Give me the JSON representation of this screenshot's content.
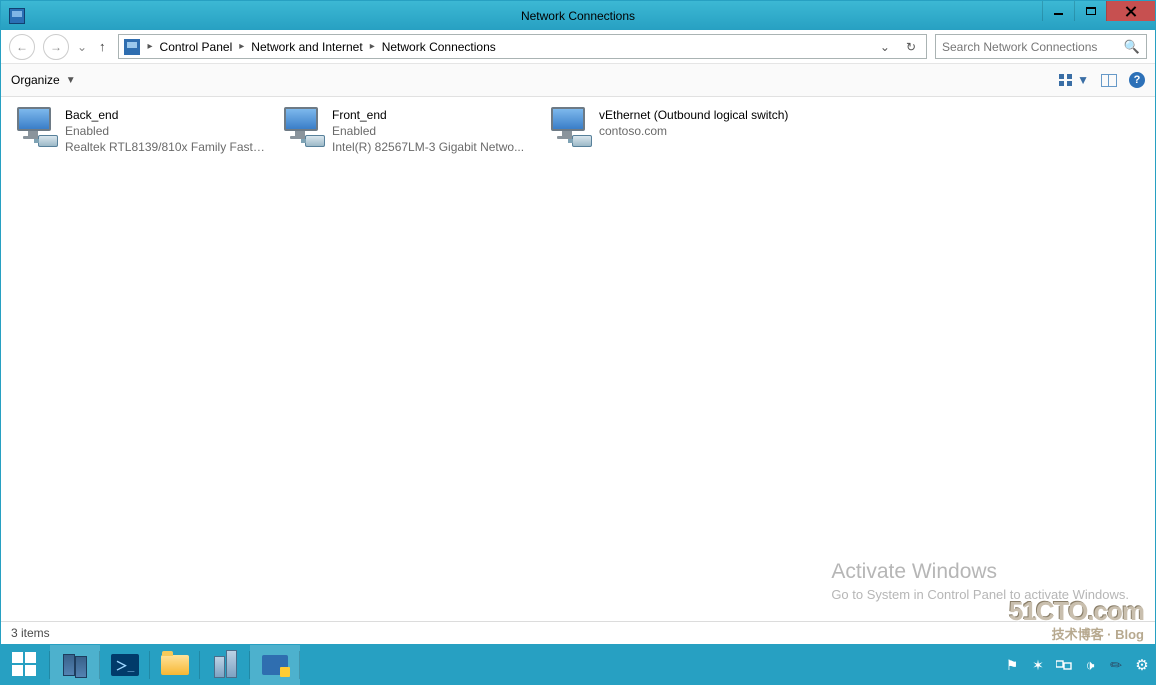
{
  "window": {
    "title": "Network Connections"
  },
  "address": {
    "crumbs": [
      "Control Panel",
      "Network and Internet",
      "Network Connections"
    ]
  },
  "search": {
    "placeholder": "Search Network Connections"
  },
  "toolbar": {
    "organize": "Organize"
  },
  "connections": [
    {
      "name": "Back_end",
      "status": "Enabled",
      "driver": "Realtek RTL8139/810x Family Fast ..."
    },
    {
      "name": "Front_end",
      "status": "Enabled",
      "driver": "Intel(R) 82567LM-3 Gigabit Netwo..."
    },
    {
      "name": "vEthernet (Outbound logical switch)",
      "status": "contoso.com",
      "driver": ""
    }
  ],
  "activate": {
    "heading": "Activate Windows",
    "sub": "Go to System in Control Panel to activate Windows."
  },
  "status": {
    "text": "3 items"
  },
  "watermark": {
    "line1": "51CTO.com",
    "line2": "技术博客 · Blog"
  }
}
